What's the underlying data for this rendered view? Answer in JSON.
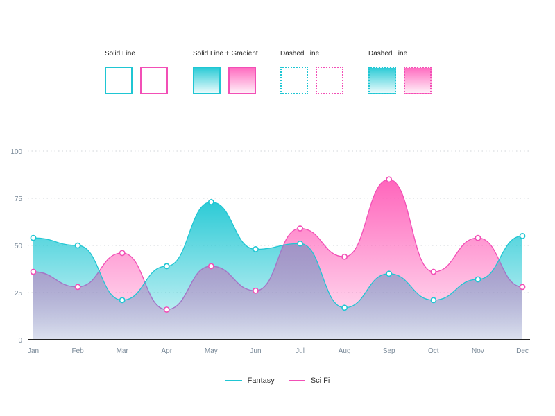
{
  "style_samples": [
    {
      "title": "Solid Line",
      "swatches": [
        "solid-cyan",
        "solid-pink"
      ]
    },
    {
      "title": "Solid Line + Gradient",
      "swatches": [
        "grad-cyan",
        "grad-pink"
      ]
    },
    {
      "title": "Dashed Line",
      "swatches": [
        "dash-cyan",
        "dash-pink"
      ]
    },
    {
      "title": "Dashed Line",
      "swatches": [
        "dashg-cyan",
        "dashg-pink"
      ]
    }
  ],
  "colors": {
    "fantasy": "#1fc6d3",
    "scifi": "#f24fb6",
    "axis": "#222222",
    "grid": "#d0d4d8",
    "tick_text": "#7a8a99"
  },
  "chart_data": {
    "type": "area",
    "title": "",
    "xlabel": "",
    "ylabel": "",
    "categories": [
      "Jan",
      "Feb",
      "Mar",
      "Apr",
      "May",
      "Jun",
      "Jul",
      "Aug",
      "Sep",
      "Oct",
      "Nov",
      "Dec"
    ],
    "yticks": [
      0,
      25,
      50,
      75,
      100
    ],
    "ylim": [
      0,
      100
    ],
    "grid": true,
    "legend_position": "bottom",
    "series": [
      {
        "name": "Fantasy",
        "color": "#1fc6d3",
        "values": [
          54,
          50,
          21,
          39,
          73,
          48,
          51,
          17,
          35,
          21,
          32,
          55
        ]
      },
      {
        "name": "Sci Fi",
        "color": "#f24fb6",
        "values": [
          36,
          28,
          46,
          16,
          39,
          26,
          59,
          44,
          85,
          36,
          54,
          28
        ]
      }
    ]
  }
}
